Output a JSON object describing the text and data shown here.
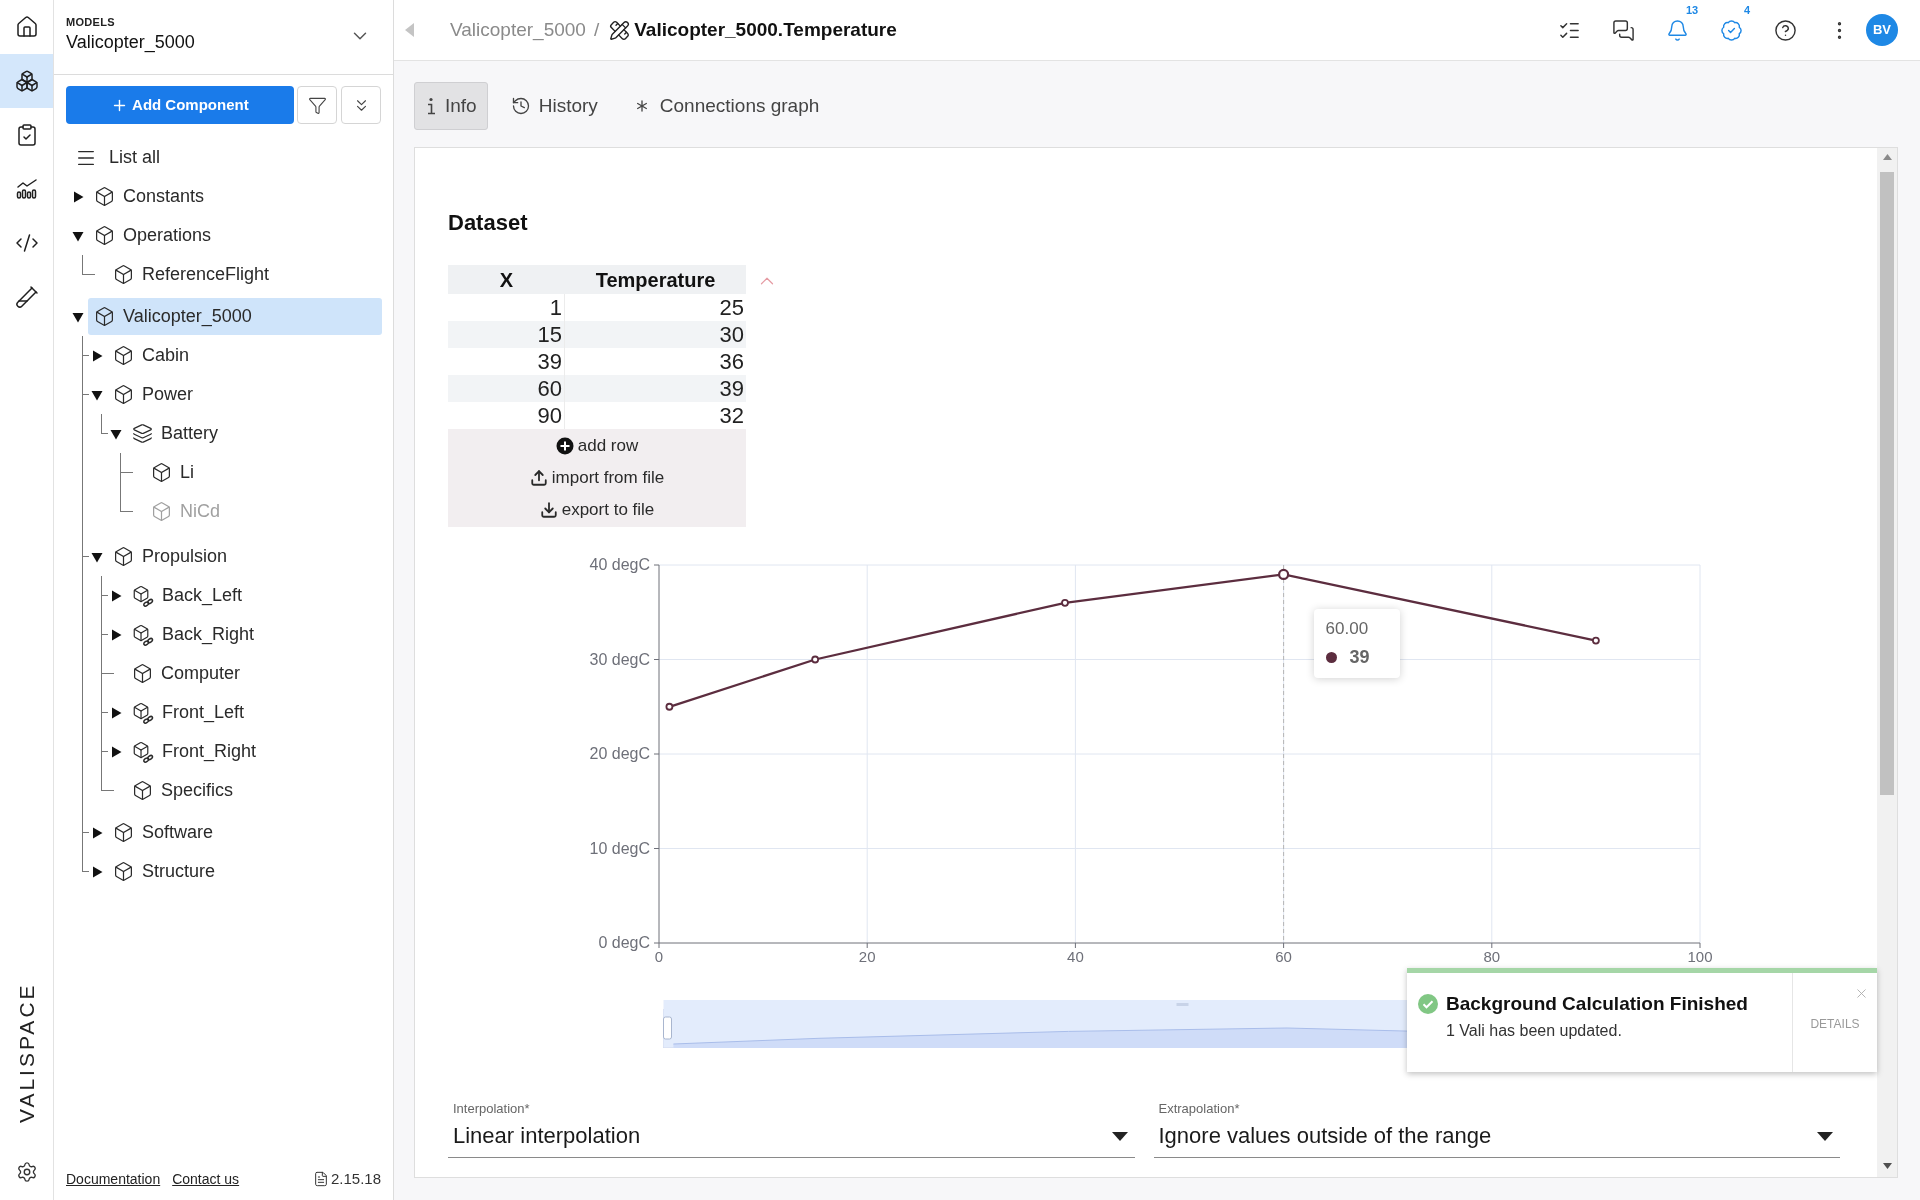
{
  "nav": {
    "items": [
      {
        "selected": false
      },
      {
        "selected": true
      },
      {
        "selected": false
      },
      {
        "selected": false
      },
      {
        "selected": false
      },
      {
        "selected": false
      }
    ],
    "logo": "VALISPACE"
  },
  "sidebar": {
    "section": "MODELS",
    "model": "Valicopter_5000",
    "add_button": "Add Component",
    "list_all": "List all",
    "tree": [
      {
        "label": "Constants",
        "kind": "component",
        "expanded": false,
        "selected": false,
        "disabled": false
      },
      {
        "label": "Operations",
        "kind": "component",
        "expanded": true,
        "selected": false,
        "disabled": false,
        "children": [
          {
            "label": "ReferenceFlight",
            "kind": "component",
            "selected": false,
            "disabled": false
          }
        ]
      },
      {
        "label": "Valicopter_5000",
        "kind": "component",
        "expanded": true,
        "selected": true,
        "disabled": false,
        "children": [
          {
            "label": "Cabin",
            "kind": "component",
            "expanded": false,
            "selected": false,
            "disabled": false
          },
          {
            "label": "Power",
            "kind": "component",
            "expanded": true,
            "selected": false,
            "disabled": false,
            "children": [
              {
                "label": "Battery",
                "kind": "stack",
                "expanded": true,
                "selected": false,
                "disabled": false,
                "children": [
                  {
                    "label": "Li",
                    "kind": "component",
                    "selected": false,
                    "disabled": false
                  },
                  {
                    "label": "NiCd",
                    "kind": "component",
                    "selected": false,
                    "disabled": true
                  }
                ]
              }
            ]
          },
          {
            "label": "Propulsion",
            "kind": "component",
            "expanded": true,
            "selected": false,
            "disabled": false,
            "children": [
              {
                "label": "Back_Left",
                "kind": "linked",
                "expanded": false,
                "selected": false,
                "disabled": false
              },
              {
                "label": "Back_Right",
                "kind": "linked",
                "expanded": false,
                "selected": false,
                "disabled": false
              },
              {
                "label": "Computer",
                "kind": "component",
                "selected": false,
                "disabled": false
              },
              {
                "label": "Front_Left",
                "kind": "linked",
                "expanded": false,
                "selected": false,
                "disabled": false
              },
              {
                "label": "Front_Right",
                "kind": "linked",
                "expanded": false,
                "selected": false,
                "disabled": false
              },
              {
                "label": "Specifics",
                "kind": "component",
                "selected": false,
                "disabled": false
              }
            ]
          },
          {
            "label": "Software",
            "kind": "component",
            "expanded": false,
            "selected": false,
            "disabled": false
          },
          {
            "label": "Structure",
            "kind": "component",
            "expanded": false,
            "selected": false,
            "disabled": false
          }
        ]
      }
    ],
    "footer": {
      "links": [
        "Documentation",
        "Contact us"
      ],
      "version": "2.15.18"
    }
  },
  "topbar": {
    "breadcrumb": {
      "parent": "Valicopter_5000",
      "separator": "/",
      "current": "Valicopter_5000.Temperature"
    },
    "notification_count": "13",
    "check_count": "4",
    "avatar": "BV"
  },
  "tabs": [
    {
      "label": "Info",
      "selected": true
    },
    {
      "label": "History",
      "selected": false
    },
    {
      "label": "Connections graph",
      "selected": false
    }
  ],
  "dataset": {
    "title": "Dataset",
    "table": {
      "columns": [
        "X",
        "Temperature"
      ],
      "rows": [
        [
          "1",
          "25"
        ],
        [
          "15",
          "30"
        ],
        [
          "39",
          "36"
        ],
        [
          "60",
          "39"
        ],
        [
          "90",
          "32"
        ]
      ]
    },
    "actions": [
      {
        "kind": "add",
        "label": "add row"
      },
      {
        "kind": "import",
        "label": "import from file"
      },
      {
        "kind": "export",
        "label": "export to file"
      }
    ],
    "chart": {
      "chart_data": {
        "type": "line",
        "x": [
          1,
          15,
          39,
          60,
          90
        ],
        "series": [
          {
            "color": "#5c2d3f",
            "marker": "circle",
            "values": [
              25,
              30,
              36,
              39,
              32
            ]
          }
        ],
        "xlim": [
          0,
          100
        ],
        "ylim": [
          0,
          40
        ],
        "xticks": [
          0,
          20,
          40,
          60,
          80,
          100
        ],
        "yticks": [
          {
            "value": 0,
            "label": "0 degC"
          },
          {
            "value": 10,
            "label": "10 degC"
          },
          {
            "value": 20,
            "label": "20 degC"
          },
          {
            "value": 30,
            "label": "30 degC"
          },
          {
            "value": 40,
            "label": "40 degC"
          }
        ],
        "grid": true,
        "ref_lines": [
          {
            "axis": "x",
            "value": 60
          }
        ]
      },
      "tooltip": {
        "title": "60.00",
        "value": "39"
      },
      "zoom_slider": {
        "level": 1
      }
    }
  },
  "fields": [
    {
      "label": "Interpolation*",
      "value": "Linear interpolation"
    },
    {
      "label": "Extrapolation*",
      "value": "Ignore values outside of the range"
    }
  ],
  "toast": {
    "title": "Background Calculation Finished",
    "message": "1 Vali has been updated.",
    "action": "DETAILS"
  }
}
